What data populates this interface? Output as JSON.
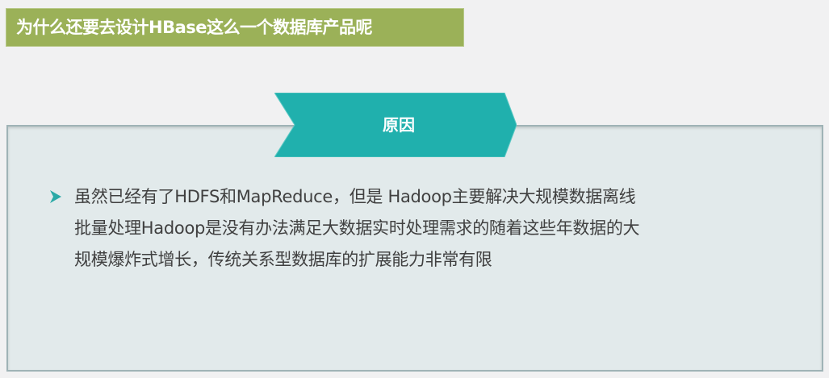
{
  "header": {
    "title": "为什么还要去设计HBase这么一个数据库产品呢"
  },
  "section": {
    "label": "原因"
  },
  "bullet": {
    "lines": [
      "虽然已经有了HDFS和MapReduce，但是 Hadoop主要解决大规模数据离线",
      "批量处理Hadoop是没有办法满足大数据实时处理需求的随着这些年数据的大",
      "规模爆炸式增长，传统关系型数据库的扩展能力非常有限"
    ]
  },
  "colors": {
    "title_bg": "#9bb158",
    "accent": "#20b0ad",
    "panel_bg": "#e2eaeb"
  }
}
